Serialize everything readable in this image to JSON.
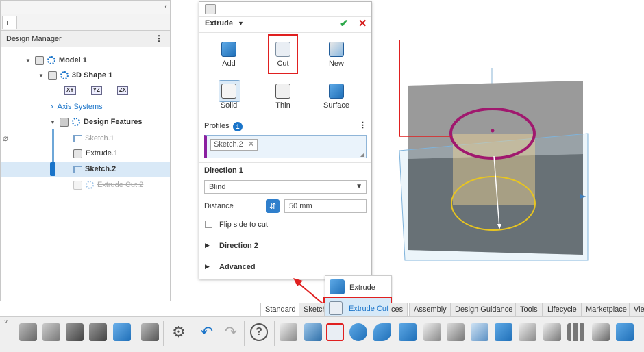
{
  "design_manager": {
    "header": "Design Manager",
    "tree": [
      {
        "label": "Model 1"
      },
      {
        "label": "3D Shape 1"
      },
      {
        "label": "Axis Systems"
      },
      {
        "label": "Design Features"
      },
      {
        "label": "Sketch.1"
      },
      {
        "label": "Extrude.1"
      },
      {
        "label": "Sketch.2"
      },
      {
        "label": "Extrude Cut.2"
      }
    ],
    "planes": [
      "XY",
      "YZ",
      "ZX"
    ]
  },
  "panel": {
    "title": "Extrude",
    "buttons": {
      "add": "Add",
      "cut": "Cut",
      "new": "New",
      "solid": "Solid",
      "thin": "Thin",
      "surface": "Surface"
    },
    "profiles_label": "Profiles",
    "profiles_count": "1",
    "profile_chip": "Sketch.2",
    "direction1_label": "Direction 1",
    "direction_type": "Blind",
    "distance_label": "Distance",
    "distance_value": "50 mm",
    "flip_label": "Flip side to cut",
    "direction2_label": "Direction 2",
    "advanced_label": "Advanced"
  },
  "popup": {
    "extrude": "Extrude",
    "extrude_cut": "Extrude Cut"
  },
  "tabs": [
    "Standard",
    "Sketch",
    "ces",
    "Assembly",
    "Design Guidance",
    "Tools",
    "Lifecycle",
    "Marketplace",
    "Vie"
  ],
  "colors": {
    "accent": "#1a74c9",
    "highlight": "#e02020",
    "circle_top": "#a0186e",
    "circle_bottom": "#e8c520"
  }
}
